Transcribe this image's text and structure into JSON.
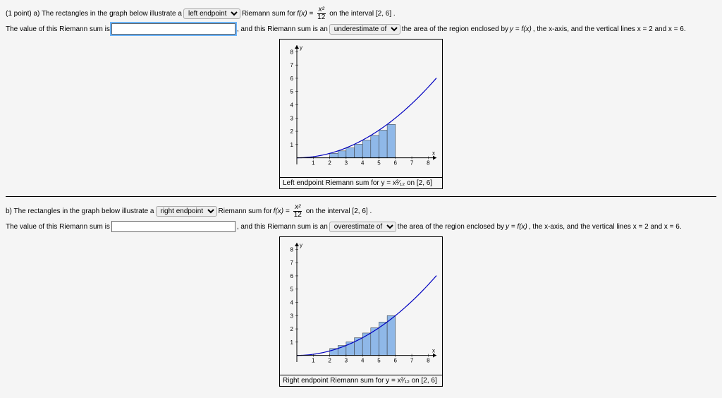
{
  "partA": {
    "prefix": "(1 point) a) The rectangles in the graph below illustrate a",
    "select1": "left endpoint",
    "mid1": "Riemann sum for",
    "fx": "f(x) =",
    "frac_num": "x²",
    "frac_den": "12",
    "mid2": "on the interval [2, 6] .",
    "line2a": "The value of this Riemann sum is",
    "line2b": ", and this Riemann sum is an",
    "select2": "underestimate of",
    "line2c": "the area of the region enclosed by",
    "yeq": "y = f(x)",
    "line2d": ", the x-axis, and the vertical lines x = 2 and x = 6.",
    "caption": "Left endpoint Riemann sum for y = x²⁄₁₂ on [2, 6]"
  },
  "partB": {
    "prefix": "b) The rectangles in the graph below illustrate a",
    "select1": "right endpoint",
    "mid1": "Riemann sum for",
    "fx": "f(x) =",
    "frac_num": "x²",
    "frac_den": "12",
    "mid2": "on the interval [2, 6] .",
    "line2a": "The value of this Riemann sum is",
    "line2b": ", and this Riemann sum is an",
    "select2": "overestimate of",
    "line2c": "the area of the region enclosed by",
    "yeq": "y = f(x)",
    "line2d": ", the x-axis, and the vertical lines x = 2 and x = 6.",
    "caption": "Right endpoint Riemann sum for y = x²⁄₁₂ on [2, 6]"
  },
  "chart_data": [
    {
      "type": "riemann",
      "title": "Left endpoint Riemann sum",
      "xrange": [
        0,
        8.5
      ],
      "yrange": [
        -0.5,
        8.5
      ],
      "xticks": [
        1,
        2,
        3,
        4,
        5,
        6,
        7,
        8
      ],
      "yticks": [
        1,
        2,
        3,
        4,
        5,
        6,
        7,
        8
      ],
      "curve": "x*x/12",
      "interval": [
        2,
        6
      ],
      "n": 8,
      "endpoint": "left"
    },
    {
      "type": "riemann",
      "title": "Right endpoint Riemann sum",
      "xrange": [
        0,
        8.5
      ],
      "yrange": [
        -0.5,
        8.5
      ],
      "xticks": [
        1,
        2,
        3,
        4,
        5,
        6,
        7,
        8
      ],
      "yticks": [
        1,
        2,
        3,
        4,
        5,
        6,
        7,
        8
      ],
      "curve": "x*x/12",
      "interval": [
        2,
        6
      ],
      "n": 8,
      "endpoint": "right"
    }
  ]
}
